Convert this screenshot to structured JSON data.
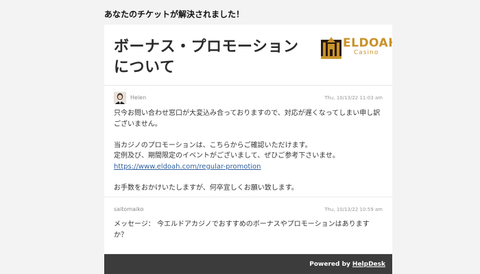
{
  "banner": "あなたのチケットが解決されました！",
  "ticket": {
    "title": "ボーナス・プロモーションについて",
    "logo": {
      "name": "ELDOAH",
      "sub": "Casino",
      "colors": {
        "gold": "#c9922a",
        "dark": "#2a1a10"
      }
    }
  },
  "messages": [
    {
      "author": "Helen",
      "date": "Thu, 10/13/22 11:03 am",
      "lines": [
        "只今お問い合わせ窓口が大変込み合っておりますので、対応が遅くなってしまい申し訳ございません。",
        "",
        "当カジノのプロモーションは、こちらからご確認いただけます。",
        "定例及び、期間限定のイベントがございまして、ぜひご参考下さいませ。"
      ],
      "link": "https://www.eldoah.com/regular-promotion",
      "closing": "お手数をおかけいたしますが、何卒宜しくお願い致します。"
    },
    {
      "author": "saitomaiko",
      "date": "Thu, 10/13/22 10:59 am",
      "text": "メッセージ： 今エルドアカジノでおすすめのボーナスやプロモーションはありますか？"
    }
  ],
  "footer": {
    "prefix": "Powered by",
    "link": "HelpDesk"
  },
  "colors": {
    "background": "#f3f3f3",
    "footer": "#3c3c3c",
    "link": "#2f5f9e"
  }
}
